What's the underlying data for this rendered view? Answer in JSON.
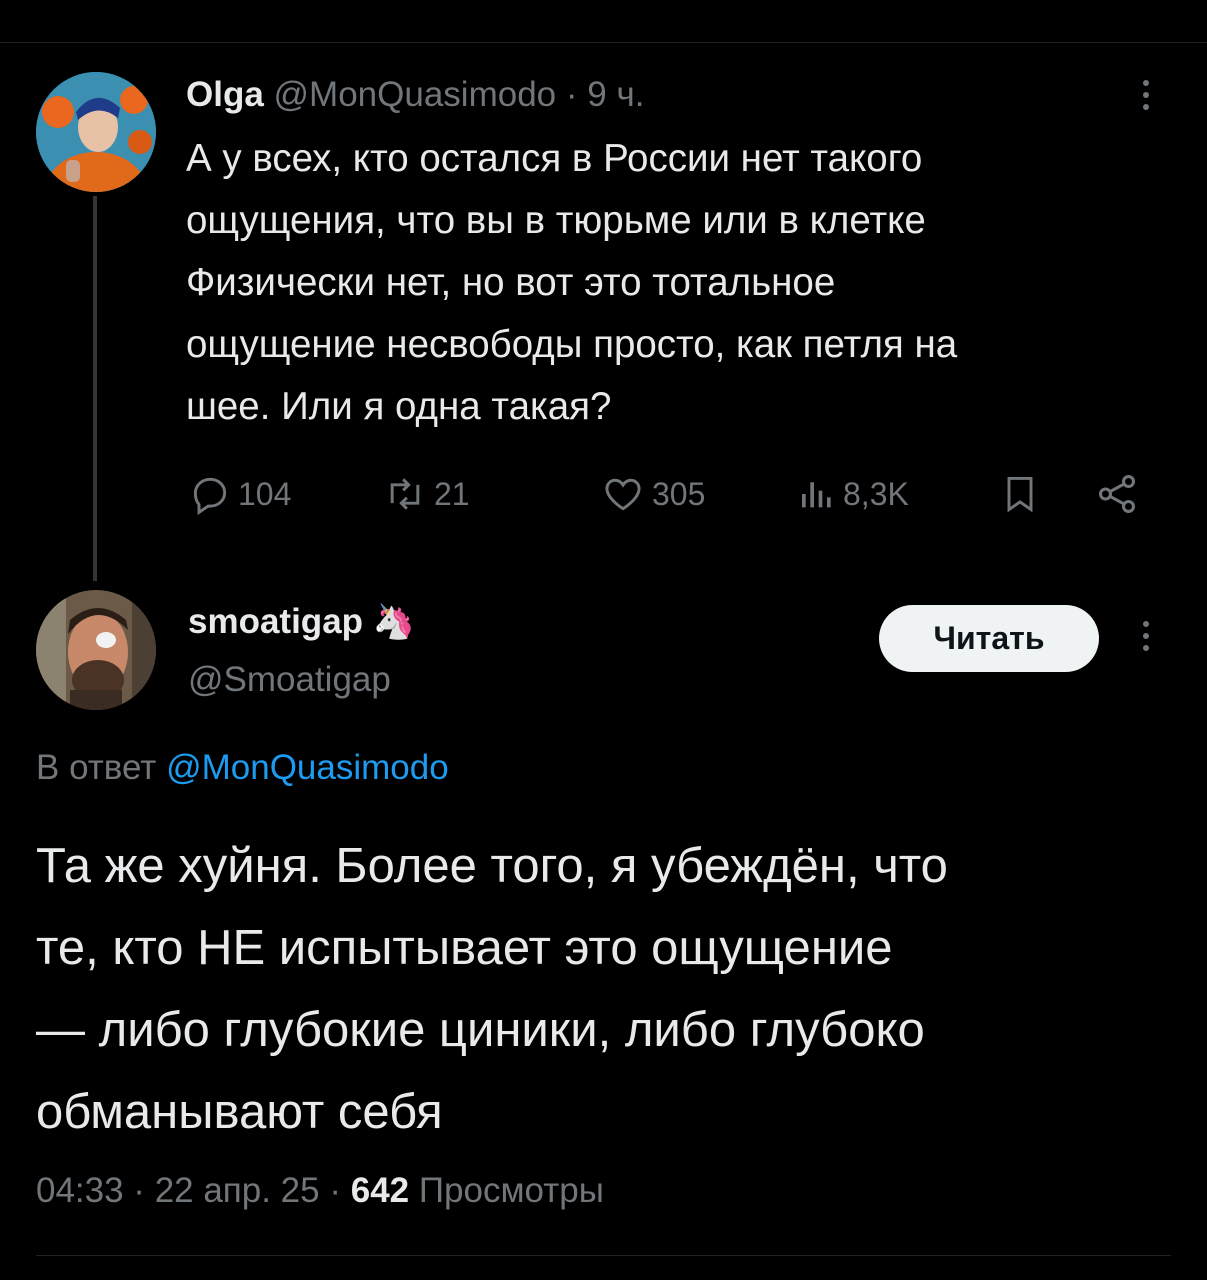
{
  "tweet": {
    "display_name": "Olga",
    "handle": "@MonQuasimodo",
    "separator": "·",
    "time": "9 ч.",
    "text_lines": [
      "А у всех, кто остался в России нет такого",
      "ощущения, что вы в тюрьме или в клетке",
      "Физически нет, но вот это тотальное",
      "ощущение несвободы просто, как петля на",
      "шее. Или я одна такая?"
    ],
    "actions": {
      "replies": "104",
      "reposts": "21",
      "likes": "305",
      "views": "8,3K"
    }
  },
  "reply": {
    "display_name": "smoatigap",
    "badge_emoji": "🦄",
    "handle": "@Smoatigap",
    "follow_label": "Читать",
    "in_reply_prefix": "В ответ",
    "in_reply_handle": "@MonQuasimodo",
    "text_lines": [
      "Та же хуйня. Более того, я убеждён, что",
      "те, кто НЕ испытывает это ощущение",
      "— либо глубокие циники, либо глубоко",
      "обманывают себя"
    ],
    "timestamp": "04:33 · 22 апр. 25 ·",
    "views_count": "642",
    "views_label": "Просмотры"
  },
  "icons": {
    "reply": "reply-icon",
    "repost": "repost-icon",
    "like": "heart-icon",
    "views": "views-icon",
    "bookmark": "bookmark-icon",
    "share": "share-icon",
    "more": "more-icon"
  },
  "colors": {
    "background": "#000000",
    "text": "#e7e9ea",
    "muted": "#71767b",
    "link": "#1d9bf0",
    "follow_button": "#eff3f4"
  }
}
